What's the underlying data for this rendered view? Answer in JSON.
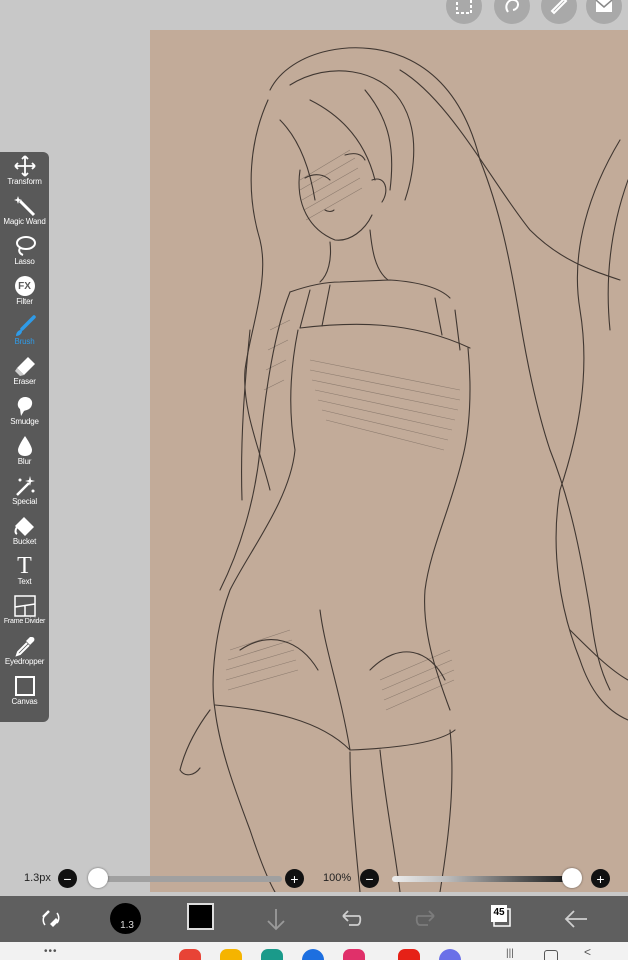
{
  "tools": [
    {
      "label": "Transform",
      "icon": "transform-icon"
    },
    {
      "label": "Magic Wand",
      "icon": "magic-wand-icon"
    },
    {
      "label": "Lasso",
      "icon": "lasso-icon"
    },
    {
      "label": "Filter",
      "icon": "fx-icon",
      "glyph": "FX"
    },
    {
      "label": "Brush",
      "icon": "brush-icon",
      "active": true
    },
    {
      "label": "Eraser",
      "icon": "eraser-icon"
    },
    {
      "label": "Smudge",
      "icon": "smudge-icon"
    },
    {
      "label": "Blur",
      "icon": "blur-drop-icon"
    },
    {
      "label": "Special",
      "icon": "special-sparkle-icon"
    },
    {
      "label": "Bucket",
      "icon": "bucket-icon"
    },
    {
      "label": "Text",
      "icon": "text-icon",
      "glyph": "T"
    },
    {
      "label": "Frame Divider",
      "icon": "frame-divider-icon"
    },
    {
      "label": "Eyedropper",
      "icon": "eyedropper-icon"
    },
    {
      "label": "Canvas",
      "icon": "canvas-icon"
    }
  ],
  "brush_slider": {
    "label": "1.3px",
    "value_fraction": 0.0
  },
  "opacity_slider": {
    "label": "100%",
    "value_fraction": 1.0
  },
  "toolbar": {
    "brush_size_badge": "1.3",
    "layer_count": "45",
    "current_color": "#000000"
  },
  "colors": {
    "canvas_background": "#c2ab99",
    "active_tool": "#2f9be8",
    "panel": "#595959",
    "toolbar": "#5f5f5f"
  },
  "top_buttons": [
    "selection-icon",
    "lasso-fill-icon",
    "ruler-icon",
    "envelope-icon"
  ]
}
